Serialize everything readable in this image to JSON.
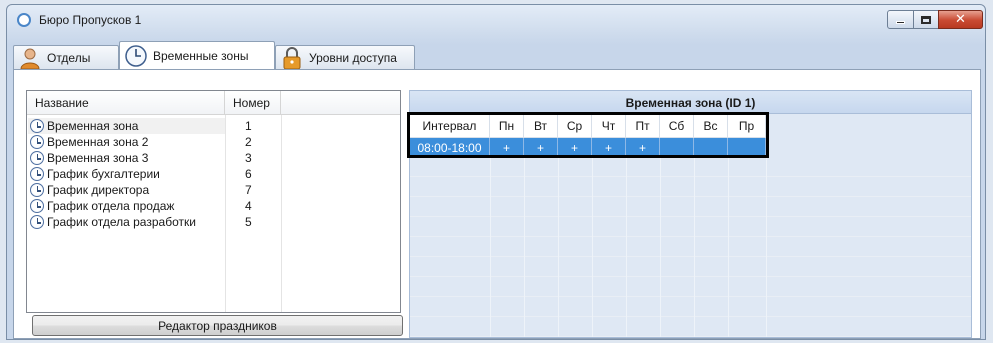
{
  "window": {
    "title": "Бюро Пропусков 1"
  },
  "tabs": [
    {
      "label": "Отделы",
      "icon": "person-icon"
    },
    {
      "label": "Временные зоны",
      "icon": "clock-icon"
    },
    {
      "label": "Уровни доступа",
      "icon": "lock-icon"
    }
  ],
  "list": {
    "columns": {
      "name": "Название",
      "number": "Номер"
    },
    "rows": [
      {
        "name": "Временная зона",
        "number": "1"
      },
      {
        "name": "Временная зона 2",
        "number": "2"
      },
      {
        "name": "Временная зона 3",
        "number": "3"
      },
      {
        "name": "График бухгалтерии",
        "number": "6"
      },
      {
        "name": "График директора",
        "number": "7"
      },
      {
        "name": "График отдела продаж",
        "number": "4"
      },
      {
        "name": "График отдела разработки",
        "number": "5"
      }
    ]
  },
  "holiday_button": "Редактор праздников",
  "zone": {
    "title": "Временная зона (ID 1)",
    "headers": [
      "Интервал",
      "Пн",
      "Вт",
      "Ср",
      "Чт",
      "Пт",
      "Сб",
      "Вс",
      "Пр"
    ],
    "row": [
      "08:00-18:00",
      "+",
      "+",
      "+",
      "+",
      "+",
      "",
      "",
      ""
    ]
  },
  "colors": {
    "selection": "#3b8edb",
    "highlight_border": "#000000"
  }
}
